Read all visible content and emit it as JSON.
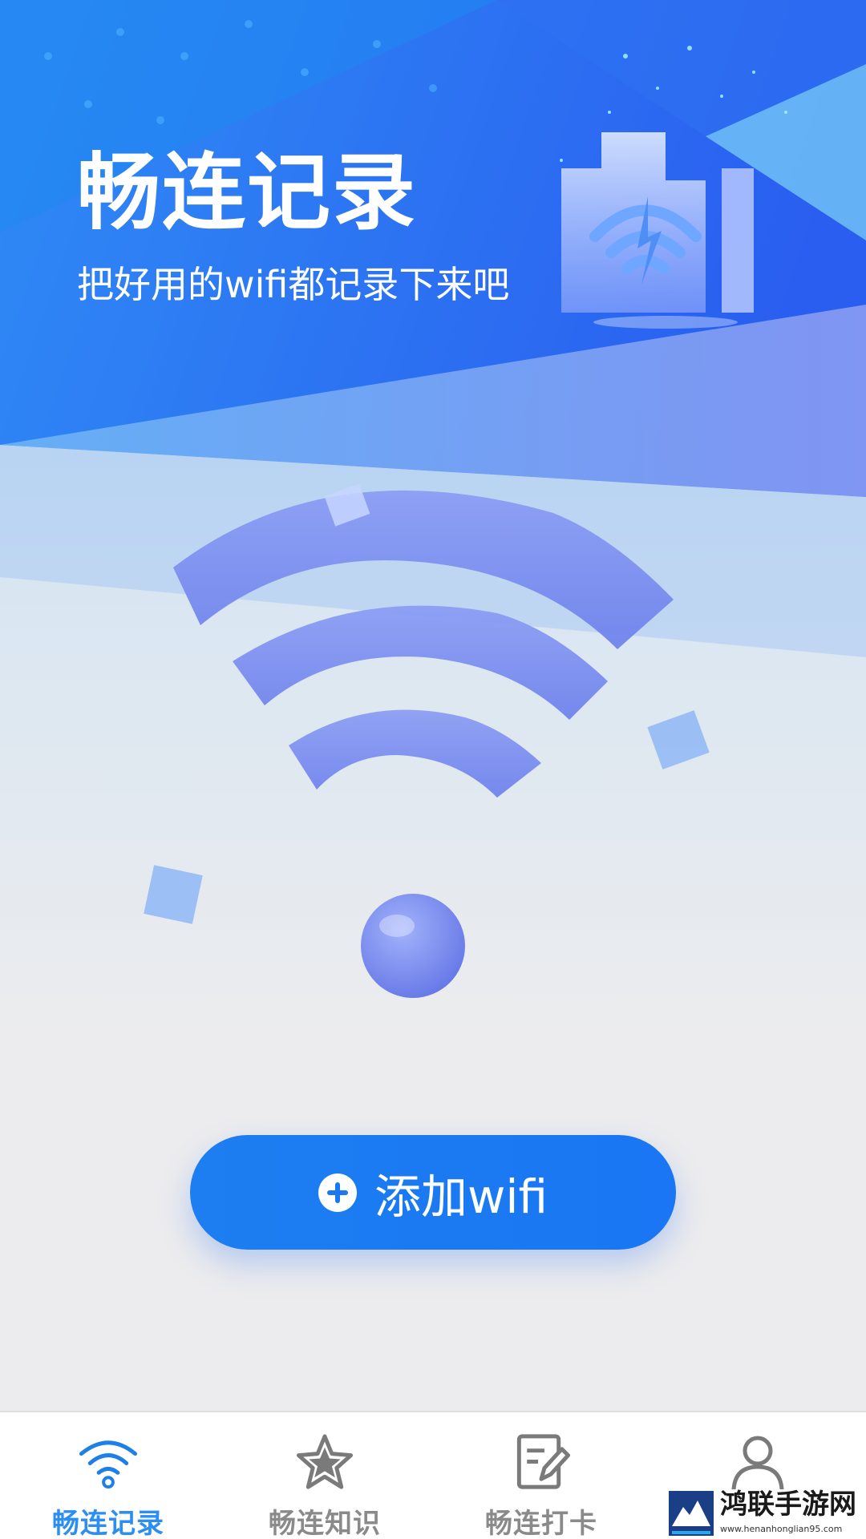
{
  "hero": {
    "title": "畅连记录",
    "subtitle": "把好用的wifi都记录下来吧"
  },
  "actions": {
    "add_wifi_label": "添加wifi"
  },
  "tabbar": {
    "tabs": [
      {
        "label": "畅连记录",
        "icon": "wifi-icon",
        "active": true
      },
      {
        "label": "畅连知识",
        "icon": "star-icon",
        "active": false
      },
      {
        "label": "畅连打卡",
        "icon": "edit-note-icon",
        "active": false
      },
      {
        "label": "",
        "icon": "user-icon",
        "active": false
      }
    ]
  },
  "watermark": {
    "name": "鸿联手游网",
    "url": "www.henanhonglian95.com"
  },
  "colors": {
    "primary": "#1a78f2",
    "tab_active": "#2b8ef0",
    "tab_inactive": "#8a8a8a",
    "wifi_symbol": "#7b8ef0"
  }
}
